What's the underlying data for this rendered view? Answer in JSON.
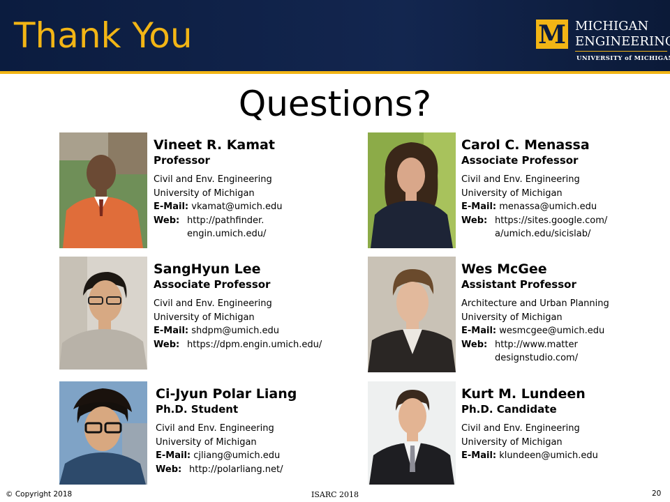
{
  "header": {
    "title": "Thank You",
    "logo": {
      "mark": "M",
      "line1": "MICHIGAN",
      "line2": "ENGINEERING",
      "line3": "UNIVERSITY of MICHIGAN",
      "colors": {
        "maize": "#F2B515",
        "blue": "#0B1C3F"
      }
    }
  },
  "subtitle": "Questions?",
  "people": [
    {
      "name": "Vineet R. Kamat",
      "role": "Professor",
      "dept": "Civil and Env. Engineering",
      "university": "University of Michigan",
      "email_label": "E-Mail:",
      "email": "vkamat@umich.edu",
      "web_label": "Web:",
      "web1": "http://pathfinder.",
      "web2": "engin.umich.edu/"
    },
    {
      "name": "Carol C. Menassa",
      "role": "Associate Professor",
      "dept": "Civil and Env. Engineering",
      "university": "University of Michigan",
      "email_label": "E-Mail:",
      "email": "menassa@umich.edu",
      "web_label": "Web:",
      "web1": "https://sites.google.com/",
      "web2": "a/umich.edu/sicislab/"
    },
    {
      "name": "SangHyun Lee",
      "role": "Associate Professor",
      "dept": "Civil and Env. Engineering",
      "university": "University of Michigan",
      "email_label": "E-Mail:",
      "email": "shdpm@umich.edu",
      "web_label": "Web:",
      "web1": "https://dpm.engin.umich.edu/"
    },
    {
      "name": "Wes McGee",
      "role": "Assistant Professor",
      "dept": "Architecture and Urban Planning",
      "university": "University of Michigan",
      "email_label": "E-Mail:",
      "email": "wesmcgee@umich.edu",
      "web_label": "Web:",
      "web1": "http://www.matter",
      "web2": "designstudio.com/"
    },
    {
      "name": "Ci-Jyun Polar Liang",
      "role": "Ph.D. Student",
      "dept": "Civil and Env. Engineering",
      "university": "University of Michigan",
      "email_label": "E-Mail:",
      "email": "cjliang@umich.edu",
      "web_label": "Web:",
      "web1": "http://polarliang.net/"
    },
    {
      "name": "Kurt M. Lundeen",
      "role": "Ph.D. Candidate",
      "dept": "Civil and Env. Engineering",
      "university": "University of Michigan",
      "email_label": "E-Mail:",
      "email": "klundeen@umich.edu"
    }
  ],
  "footer": {
    "copyright": "© Copyright 2018",
    "conference": "ISARC 2018",
    "page": "20"
  }
}
